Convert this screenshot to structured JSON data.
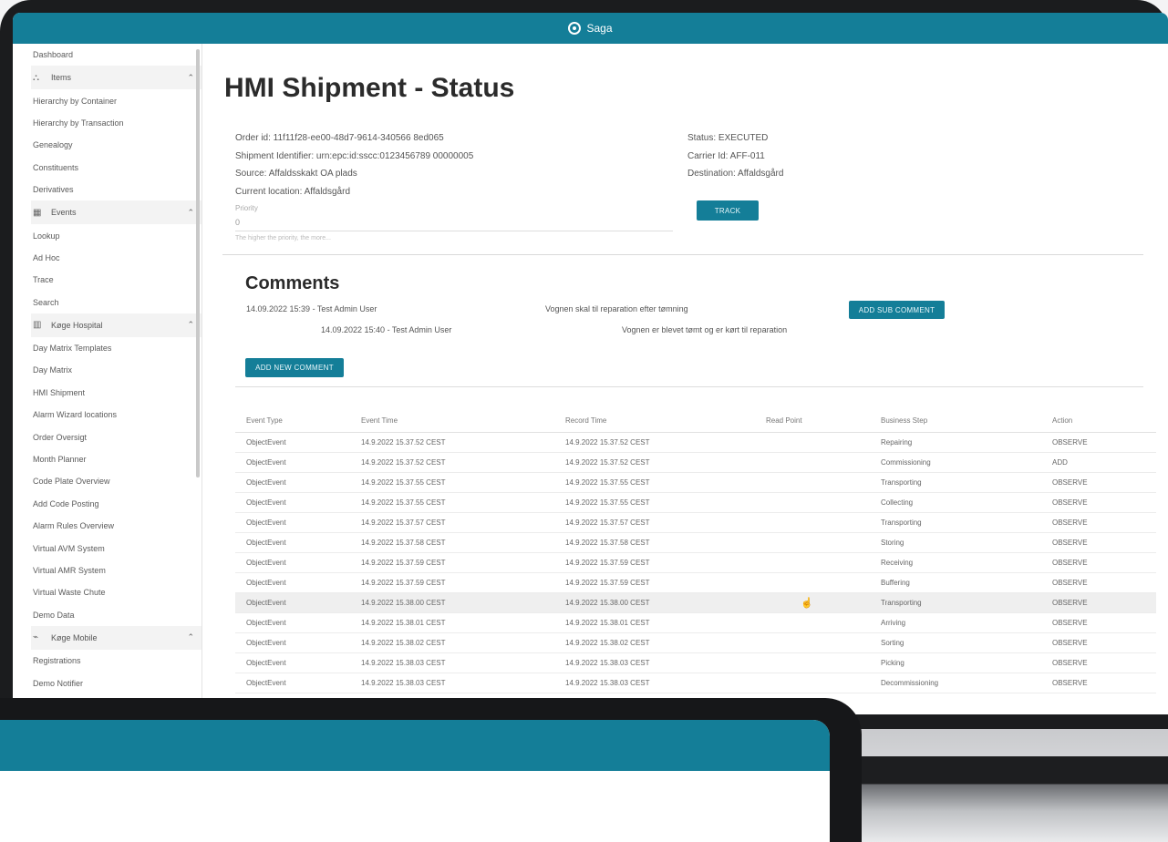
{
  "app": {
    "brand": "Saga",
    "accent": "#147e98"
  },
  "sidebar": {
    "items": [
      {
        "type": "item",
        "label": "Dashboard"
      },
      {
        "type": "group",
        "label": "Items",
        "icon": "hierarchy-icon"
      },
      {
        "type": "item",
        "label": "Hierarchy by Container"
      },
      {
        "type": "item",
        "label": "Hierarchy by Transaction"
      },
      {
        "type": "item",
        "label": "Genealogy"
      },
      {
        "type": "item",
        "label": "Constituents"
      },
      {
        "type": "item",
        "label": "Derivatives"
      },
      {
        "type": "group",
        "label": "Events",
        "icon": "calendar-icon"
      },
      {
        "type": "item",
        "label": "Lookup"
      },
      {
        "type": "item",
        "label": "Ad Hoc"
      },
      {
        "type": "item",
        "label": "Trace"
      },
      {
        "type": "item",
        "label": "Search"
      },
      {
        "type": "group",
        "label": "Køge Hospital",
        "icon": "building-icon"
      },
      {
        "type": "item",
        "label": "Day Matrix Templates"
      },
      {
        "type": "item",
        "label": "Day Matrix"
      },
      {
        "type": "item",
        "label": "HMI Shipment"
      },
      {
        "type": "item",
        "label": "Alarm Wizard locations"
      },
      {
        "type": "item",
        "label": "Order Oversigt"
      },
      {
        "type": "item",
        "label": "Month Planner"
      },
      {
        "type": "item",
        "label": "Code Plate Overview"
      },
      {
        "type": "item",
        "label": "Add Code Posting"
      },
      {
        "type": "item",
        "label": "Alarm Rules Overview"
      },
      {
        "type": "item",
        "label": "Virtual AVM System"
      },
      {
        "type": "item",
        "label": "Virtual AMR System"
      },
      {
        "type": "item",
        "label": "Virtual Waste Chute"
      },
      {
        "type": "item",
        "label": "Demo Data"
      },
      {
        "type": "group",
        "label": "Køge Mobile",
        "icon": "mobile-icon"
      },
      {
        "type": "item",
        "label": "Registrations"
      },
      {
        "type": "item",
        "label": "Demo Notifier"
      }
    ]
  },
  "page": {
    "title": "HMI Shipment - Status"
  },
  "shipment": {
    "left": [
      "Order id: 11f11f28-ee00-48d7-9614-340566 8ed065",
      "Shipment Identifier: urn:epc:id:sscc:0123456789 00000005",
      "Source: Affaldsskakt OA plads",
      "Current location: Affaldsgård"
    ],
    "right": [
      "Status: EXECUTED",
      "Carrier Id: AFF-011",
      "Destination: Affaldsgård"
    ],
    "priority_label": "Priority",
    "priority_value": "0",
    "priority_help": "The higher the priority, the more...",
    "track_button": "TRACK"
  },
  "comments": {
    "title": "Comments",
    "entries": [
      {
        "meta": "14.09.2022 15:39 - Test Admin User",
        "text": "Vognen skal til reparation efter tømning"
      },
      {
        "meta": "14.09.2022 15:40 - Test Admin User",
        "text": "Vognen er blevet tømt og er kørt til reparation"
      }
    ],
    "add_sub_button": "ADD SUB COMMENT",
    "add_new_button": "ADD NEW COMMENT"
  },
  "events": {
    "headers": [
      "Event Type",
      "Event Time",
      "Record Time",
      "Read Point",
      "Business Step",
      "Action"
    ],
    "rows": [
      [
        "ObjectEvent",
        "14.9.2022 15.37.52 CEST",
        "14.9.2022 15.37.52 CEST",
        "",
        "Repairing",
        "OBSERVE"
      ],
      [
        "ObjectEvent",
        "14.9.2022 15.37.52 CEST",
        "14.9.2022 15.37.52 CEST",
        "",
        "Commissioning",
        "ADD"
      ],
      [
        "ObjectEvent",
        "14.9.2022 15.37.55 CEST",
        "14.9.2022 15.37.55 CEST",
        "",
        "Transporting",
        "OBSERVE"
      ],
      [
        "ObjectEvent",
        "14.9.2022 15.37.55 CEST",
        "14.9.2022 15.37.55 CEST",
        "",
        "Collecting",
        "OBSERVE"
      ],
      [
        "ObjectEvent",
        "14.9.2022 15.37.57 CEST",
        "14.9.2022 15.37.57 CEST",
        "",
        "Transporting",
        "OBSERVE"
      ],
      [
        "ObjectEvent",
        "14.9.2022 15.37.58 CEST",
        "14.9.2022 15.37.58 CEST",
        "",
        "Storing",
        "OBSERVE"
      ],
      [
        "ObjectEvent",
        "14.9.2022 15.37.59 CEST",
        "14.9.2022 15.37.59 CEST",
        "",
        "Receiving",
        "OBSERVE"
      ],
      [
        "ObjectEvent",
        "14.9.2022 15.37.59 CEST",
        "14.9.2022 15.37.59 CEST",
        "",
        "Buffering",
        "OBSERVE"
      ],
      [
        "ObjectEvent",
        "14.9.2022 15.38.00 CEST",
        "14.9.2022 15.38.00 CEST",
        "",
        "Transporting",
        "OBSERVE"
      ],
      [
        "ObjectEvent",
        "14.9.2022 15.38.01 CEST",
        "14.9.2022 15.38.01 CEST",
        "",
        "Arriving",
        "OBSERVE"
      ],
      [
        "ObjectEvent",
        "14.9.2022 15.38.02 CEST",
        "14.9.2022 15.38.02 CEST",
        "",
        "Sorting",
        "OBSERVE"
      ],
      [
        "ObjectEvent",
        "14.9.2022 15.38.03 CEST",
        "14.9.2022 15.38.03 CEST",
        "",
        "Picking",
        "OBSERVE"
      ],
      [
        "ObjectEvent",
        "14.9.2022 15.38.03 CEST",
        "14.9.2022 15.38.03 CEST",
        "",
        "Decommissioning",
        "OBSERVE"
      ]
    ],
    "highlighted_row": 8
  }
}
